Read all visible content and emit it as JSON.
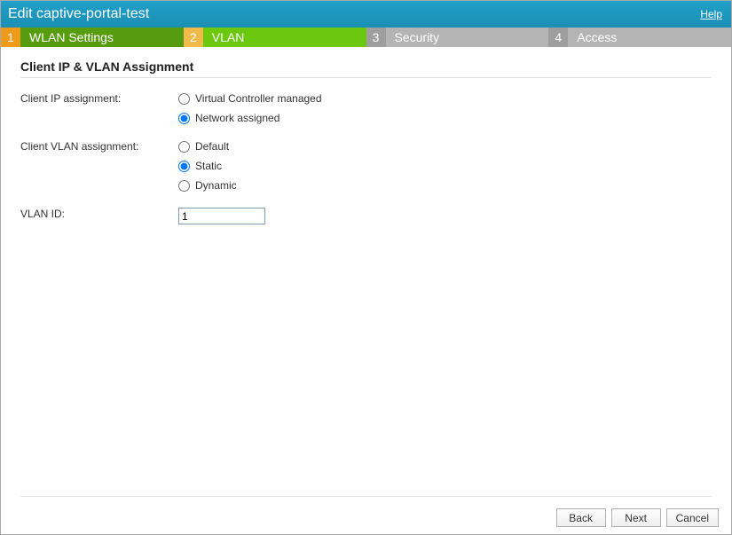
{
  "title": "Edit captive-portal-test",
  "help_label": "Help",
  "steps": [
    {
      "num": "1",
      "label": "WLAN Settings"
    },
    {
      "num": "2",
      "label": "VLAN"
    },
    {
      "num": "3",
      "label": "Security"
    },
    {
      "num": "4",
      "label": "Access"
    }
  ],
  "page_heading": "Client IP & VLAN Assignment",
  "labels": {
    "ip_assignment": "Client IP assignment:",
    "vlan_assignment": "Client VLAN assignment:",
    "vlan_id": "VLAN ID:"
  },
  "ip_options": {
    "virtual": "Virtual Controller managed",
    "network": "Network assigned"
  },
  "vlan_options": {
    "default": "Default",
    "static": "Static",
    "dynamic": "Dynamic"
  },
  "vlan_id_value": "1",
  "buttons": {
    "back": "Back",
    "next": "Next",
    "cancel": "Cancel"
  }
}
